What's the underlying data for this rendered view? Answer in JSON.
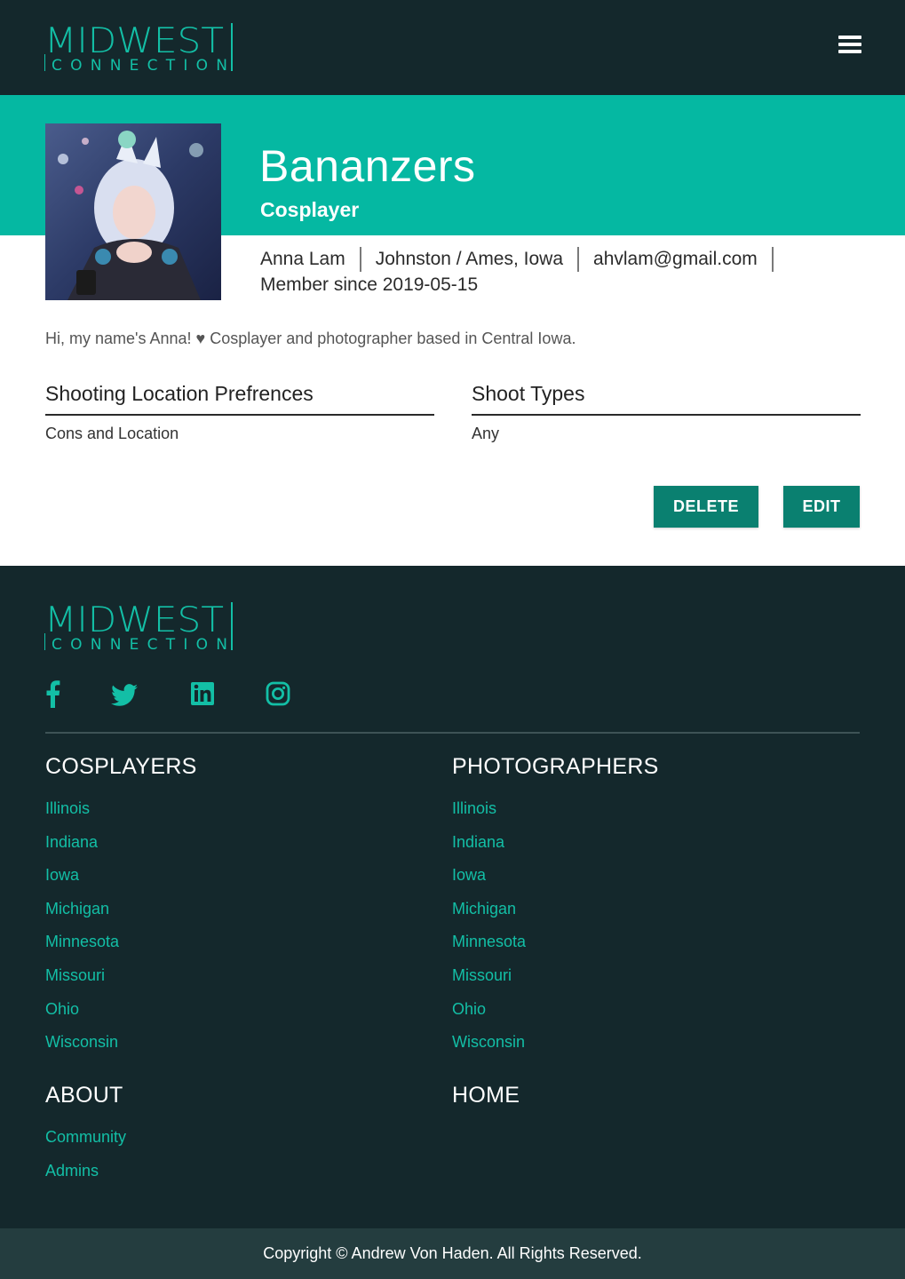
{
  "header": {
    "logo_text": "MIDWEST",
    "logo_subtext": "CONNECTION",
    "menu_icon": "hamburger-menu-icon"
  },
  "profile": {
    "name": "Bananzers",
    "role": "Cosplayer",
    "real_name": "Anna Lam",
    "location": "Johnston / Ames, Iowa",
    "email": "ahvlam@gmail.com",
    "member_since": "Member since 2019-05-15",
    "bio": "Hi, my name's Anna! ♥ Cosplayer and photographer based in Central Iowa.",
    "preferences": [
      {
        "title": "Shooting Location Prefrences",
        "value": "Cons and Location"
      },
      {
        "title": "Shoot Types",
        "value": "Any"
      }
    ],
    "buttons": {
      "delete": "DELETE",
      "edit": "EDIT"
    }
  },
  "footer": {
    "logo_text": "MIDWEST",
    "logo_subtext": "CONNECTION",
    "social_icons": [
      "facebook-icon",
      "twitter-icon",
      "linkedin-icon",
      "instagram-icon"
    ],
    "cosplayers": {
      "heading": "COSPLAYERS",
      "links": [
        "Illinois",
        "Indiana",
        "Iowa",
        "Michigan",
        "Minnesota",
        "Missouri",
        "Ohio",
        "Wisconsin"
      ]
    },
    "photographers": {
      "heading": "PHOTOGRAPHERS",
      "links": [
        "Illinois",
        "Indiana",
        "Iowa",
        "Michigan",
        "Minnesota",
        "Missouri",
        "Ohio",
        "Wisconsin"
      ]
    },
    "about": {
      "heading": "ABOUT",
      "links": [
        "Community",
        "Admins"
      ]
    },
    "home": {
      "heading": "HOME"
    },
    "copyright": "Copyright © Andrew Von Haden. All Rights Reserved."
  },
  "colors": {
    "dark": "#14282c",
    "teal": "#05b8a2",
    "button": "#0a8070",
    "link": "#13bfa6"
  }
}
